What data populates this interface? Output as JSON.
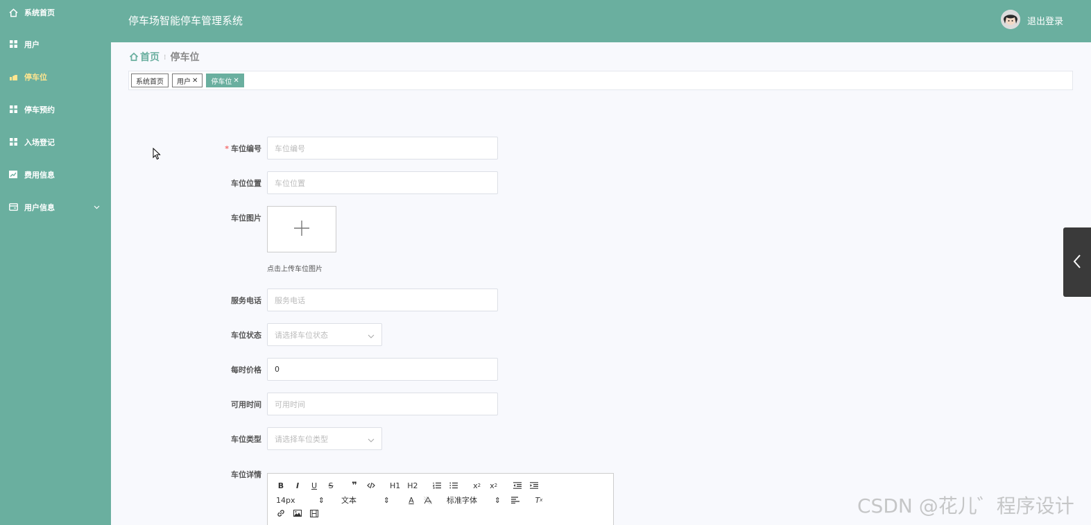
{
  "app": {
    "title": "停车场智能停车管理系统",
    "logout_label": "退出登录"
  },
  "sidebar": {
    "items": [
      {
        "label": "系统首页",
        "icon": "home-icon"
      },
      {
        "label": "用户",
        "icon": "grid-icon"
      },
      {
        "label": "停车位",
        "icon": "parking-icon",
        "active": true
      },
      {
        "label": "停车预约",
        "icon": "grid-icon"
      },
      {
        "label": "入场登记",
        "icon": "grid-icon"
      },
      {
        "label": "费用信息",
        "icon": "chart-icon"
      },
      {
        "label": "用户信息",
        "icon": "card-icon",
        "has_children": true
      }
    ]
  },
  "breadcrumb": {
    "home": "首页",
    "current": "停车位"
  },
  "tags": [
    {
      "label": "系统首页",
      "closable": false
    },
    {
      "label": "用户",
      "closable": true
    },
    {
      "label": "停车位",
      "closable": true,
      "active": true
    }
  ],
  "form": {
    "slot_number": {
      "label": "车位编号",
      "placeholder": "车位编号",
      "required": true
    },
    "slot_location": {
      "label": "车位位置",
      "placeholder": "车位位置"
    },
    "slot_image": {
      "label": "车位图片",
      "tip": "点击上传车位图片"
    },
    "service_phone": {
      "label": "服务电话",
      "placeholder": "服务电话"
    },
    "slot_status": {
      "label": "车位状态",
      "placeholder": "请选择车位状态"
    },
    "hourly_price": {
      "label": "每时价格",
      "value": "0"
    },
    "available_time": {
      "label": "可用时间",
      "placeholder": "可用时间"
    },
    "slot_type": {
      "label": "车位类型",
      "placeholder": "请选择车位类型"
    },
    "slot_detail": {
      "label": "车位详情"
    }
  },
  "editor": {
    "font_size": "14px",
    "header_type": "文本",
    "font_family": "标准字体",
    "buttons": [
      "B",
      "I",
      "U",
      "S",
      "H1",
      "H2"
    ]
  },
  "watermark": "CSDN @花儿゛程序设计",
  "colors": {
    "primary": "#6aaf9f",
    "active_menu": "#ffe58f",
    "required": "#f56c6c"
  }
}
